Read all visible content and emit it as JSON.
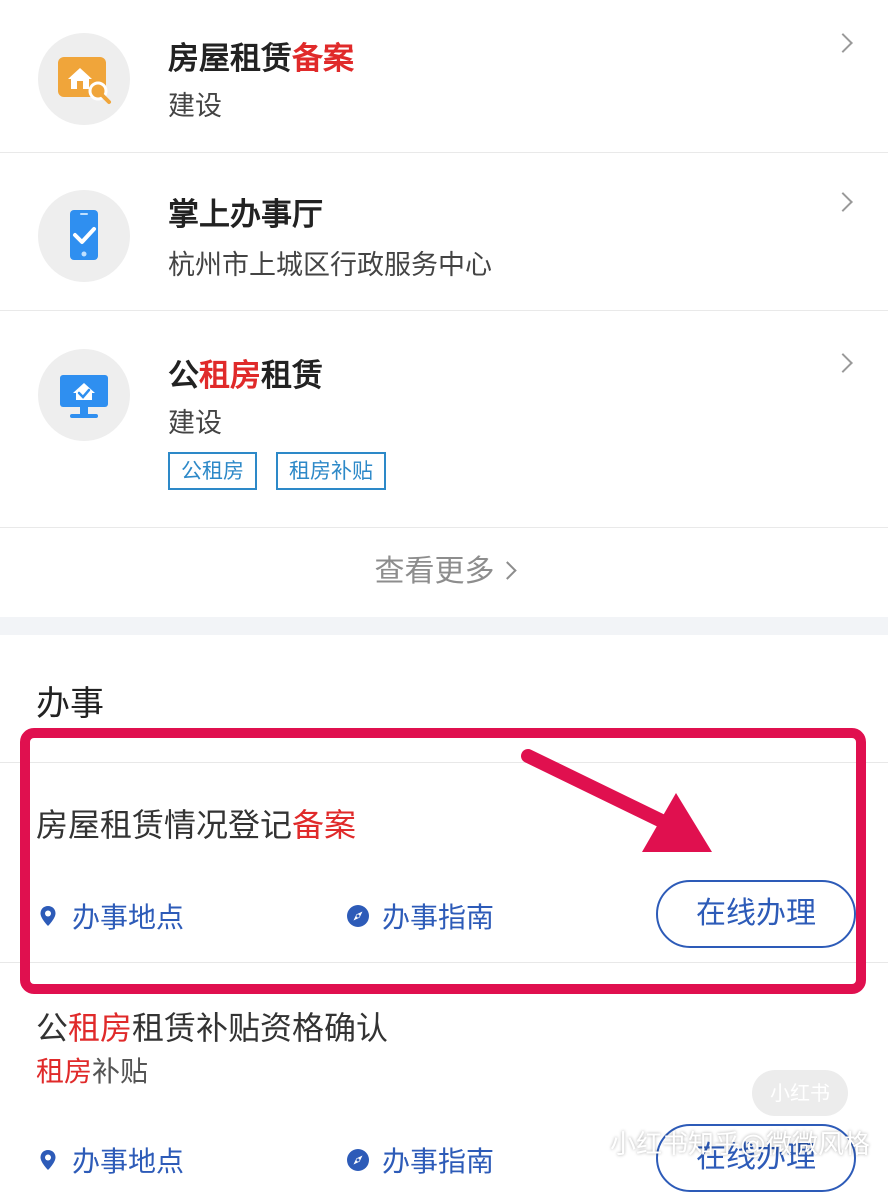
{
  "services": [
    {
      "title_parts": [
        "房屋租赁",
        "备案"
      ],
      "subtitle": "建设",
      "icon": "house-search-icon",
      "icon_color": "#f0a53a"
    },
    {
      "title": "掌上办事厅",
      "subtitle": "杭州市上城区行政服务中心",
      "icon": "mobile-check-icon",
      "icon_color": "#2f8ff0"
    },
    {
      "title_parts": [
        "公",
        "租房",
        "租赁"
      ],
      "subtitle": "建设",
      "icon": "monitor-house-icon",
      "icon_color": "#2f8ff0",
      "tags": [
        "公租房",
        "租房补贴"
      ]
    }
  ],
  "more_label": "查看更多",
  "section_title": "办事",
  "items": [
    {
      "title_parts": [
        "房屋租赁情况登记",
        "备案"
      ],
      "location_label": "办事地点",
      "guide_label": "办事指南",
      "online_label": "在线办理"
    },
    {
      "title_parts": [
        "公",
        "租房",
        "租赁补贴资格确认"
      ],
      "tag_parts": [
        "租房",
        "补贴"
      ],
      "location_label": "办事地点",
      "guide_label": "办事指南",
      "online_label": "在线办理"
    }
  ],
  "watermark": "小红书知乎@微微风格",
  "watermark_badge": "小红书",
  "colors": {
    "accent_red": "#e02a2a",
    "link_blue": "#2d5bb8",
    "tag_blue": "#2d89c8",
    "highlight": "#e0104f"
  }
}
